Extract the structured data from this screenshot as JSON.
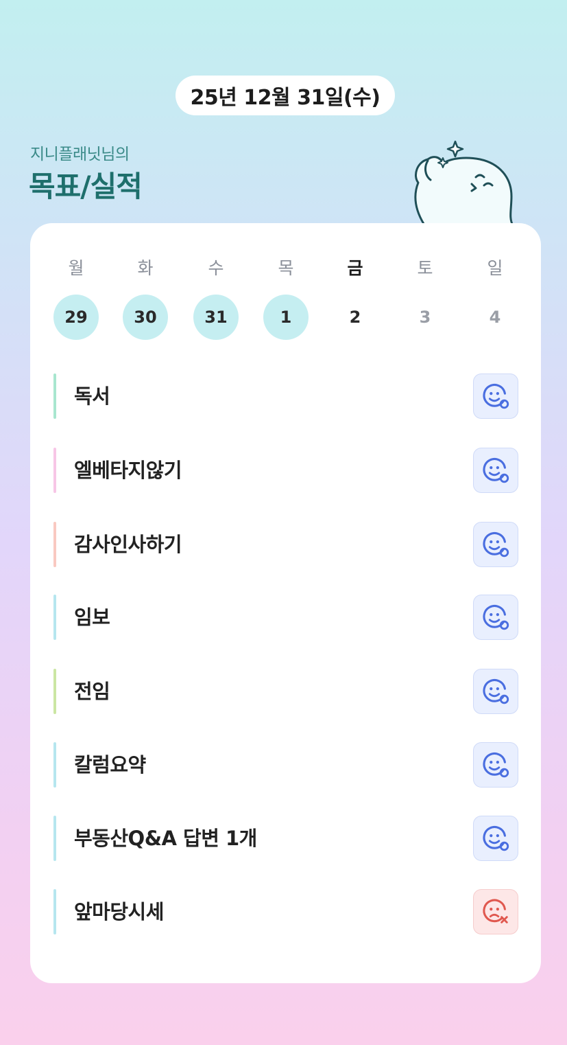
{
  "date_label": "25년 12월 31일(수)",
  "owner_label": "지니플래닛님의",
  "heading": "목표/실적",
  "colors": {
    "teal_heading": "#1e6f6c",
    "filled_day": "#c5eef1",
    "ok_icon": "#4a6ee0",
    "fail_icon": "#e0584f"
  },
  "week": {
    "days": [
      {
        "dow": "월",
        "num": "29",
        "state": "filled"
      },
      {
        "dow": "화",
        "num": "30",
        "state": "filled"
      },
      {
        "dow": "수",
        "num": "31",
        "state": "filled"
      },
      {
        "dow": "목",
        "num": "1",
        "state": "filled"
      },
      {
        "dow": "금",
        "num": "2",
        "state": "today"
      },
      {
        "dow": "토",
        "num": "3",
        "state": "future"
      },
      {
        "dow": "일",
        "num": "4",
        "state": "future"
      }
    ]
  },
  "goals": [
    {
      "label": "독서",
      "bar_color": "#a8e6cf",
      "status": "done",
      "icon": "smile-check-icon"
    },
    {
      "label": "엘베타지않기",
      "bar_color": "#f7c6e6",
      "status": "done",
      "icon": "smile-check-icon"
    },
    {
      "label": "감사인사하기",
      "bar_color": "#f9c9c1",
      "status": "done",
      "icon": "smile-check-icon"
    },
    {
      "label": "임보",
      "bar_color": "#b6e6ef",
      "status": "done",
      "icon": "smile-check-icon"
    },
    {
      "label": "전임",
      "bar_color": "#cbe6a3",
      "status": "done",
      "icon": "smile-check-icon"
    },
    {
      "label": "칼럼요약",
      "bar_color": "#b6e6ef",
      "status": "done",
      "icon": "smile-check-icon"
    },
    {
      "label": "부동산Q&A 답변 1개",
      "bar_color": "#b6e6ef",
      "status": "done",
      "icon": "smile-check-icon"
    },
    {
      "label": "앞마당시세",
      "bar_color": "#b6e6ef",
      "status": "failed",
      "icon": "sad-x-icon"
    }
  ]
}
